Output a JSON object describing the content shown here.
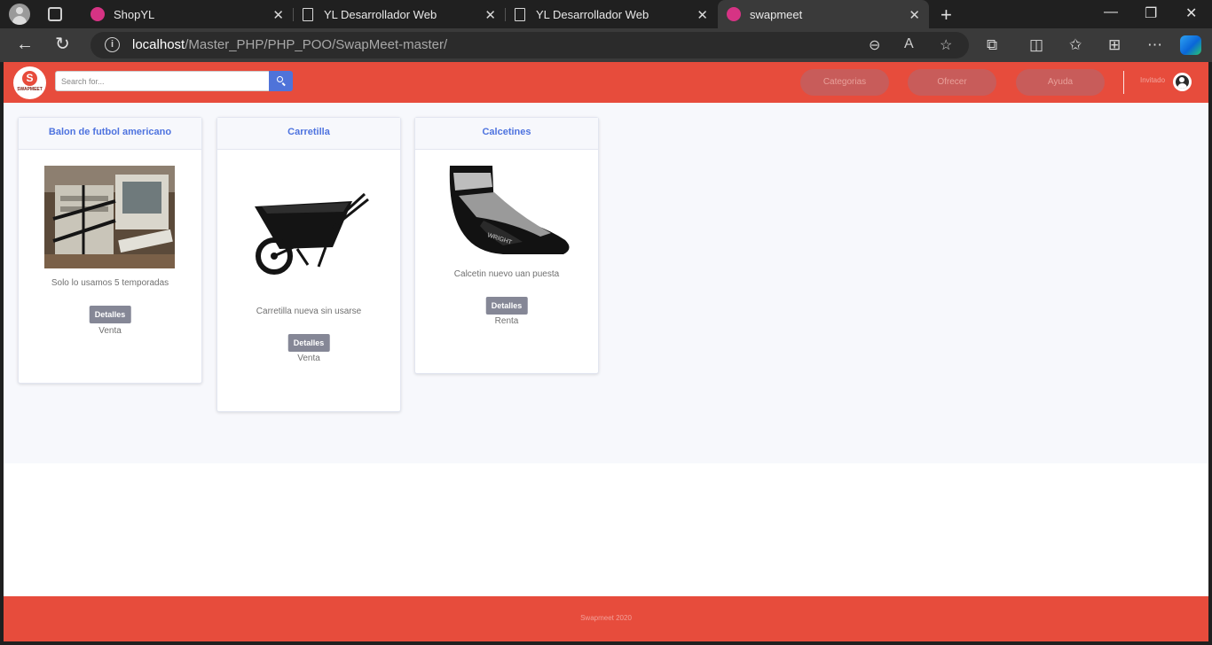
{
  "browser": {
    "tabs": [
      {
        "title": "ShopYL",
        "favicon": "shop-favicon"
      },
      {
        "title": "YL Desarrollador Web",
        "favicon": "document-icon"
      },
      {
        "title": "YL Desarrollador Web",
        "favicon": "document-icon"
      },
      {
        "title": "swapmeet",
        "favicon": "swapmeet-favicon"
      }
    ],
    "url_host": "localhost",
    "url_path": "/Master_PHP/PHP_POO/SwapMeet-master/"
  },
  "header": {
    "logo_letter": "S",
    "logo_word": "SWAPMEET",
    "search_placeholder": "Search for...",
    "nav": [
      "Categorias",
      "Ofrecer",
      "Ayuda"
    ],
    "user_label": "Invitado"
  },
  "products": [
    {
      "title": "Balon de futbol americano",
      "description": "Solo lo usamos 5 temporadas",
      "button": "Detalles",
      "mode": "Venta"
    },
    {
      "title": "Carretilla",
      "description": "Carretilla nueva sin usarse",
      "button": "Detalles",
      "mode": "Venta"
    },
    {
      "title": "Calcetines",
      "description": "Calcetin nuevo uan puesta",
      "button": "Detalles",
      "mode": "Renta"
    }
  ],
  "footer": {
    "text": "Swapmeet 2020"
  },
  "colors": {
    "brand": "#e74c3c",
    "accent": "#4e73df",
    "button": "#858796"
  }
}
